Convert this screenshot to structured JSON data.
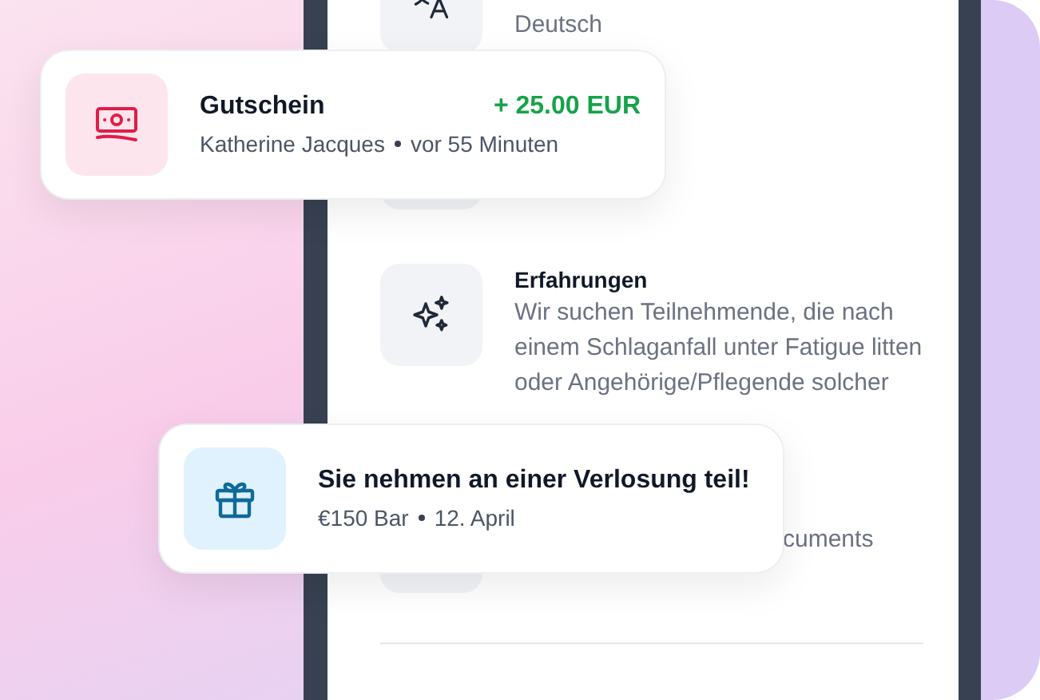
{
  "phone": {
    "items": [
      {
        "kind": "language",
        "description": "Deutsch"
      },
      {
        "kind": "covered"
      },
      {
        "kind": "experience",
        "title": "Erfahrungen",
        "description": "Wir suchen Teilnehmende, die nach einem Schlaganfall unter Fatigue litten oder Angehörige/Pflegende solcher"
      },
      {
        "kind": "covered",
        "description": "cuments",
        "cut_left": true
      }
    ]
  },
  "cards": [
    {
      "kind": "voucher",
      "title": "Gutschein",
      "amount": "+ 25.00 EUR",
      "subtitle": [
        "Katherine Jacques",
        "vor 55 Minuten"
      ]
    },
    {
      "kind": "raffle",
      "title": "Sie nehmen an einer Verlosung teil!",
      "subtitle": [
        "€150 Bar",
        "12. April"
      ]
    }
  ]
}
